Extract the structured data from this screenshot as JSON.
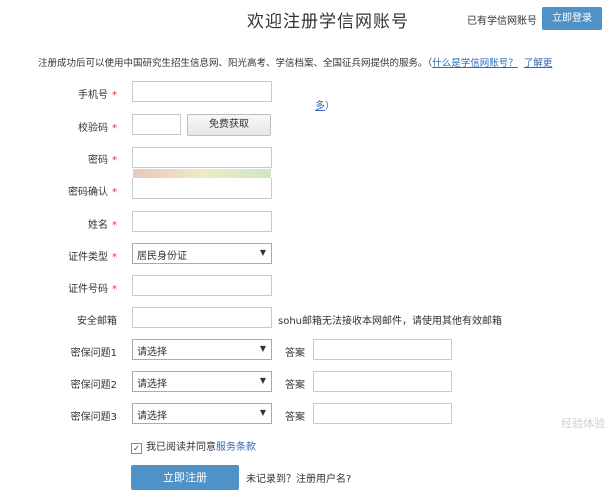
{
  "header": {
    "title": "欢迎注册学信网账号",
    "has_account": "已有学信网账号",
    "login_button": "立即登录"
  },
  "intro": {
    "text": "注册成功后可以使用中国研究生招生信息网、阳光高考、学信档案、全国征兵网提供的服务。（",
    "link1": "什么是学信网账号？",
    "link2": "了解更",
    "more": "多",
    "close_paren": "）"
  },
  "form": {
    "phone_label": "手机号",
    "code_label": "校验码",
    "code_button": "免费获取",
    "password_label": "密码",
    "password_confirm_label": "密码确认",
    "name_label": "姓名",
    "id_type_label": "证件类型",
    "id_type_value": "居民身份证",
    "id_number_label": "证件号码",
    "email_label": "安全邮箱",
    "email_hint": "sohu邮箱无法接收本网邮件，请使用其他有效邮箱",
    "q1_label": "密保问题1",
    "q2_label": "密保问题2",
    "q3_label": "密保问题3",
    "select_placeholder": "请选择",
    "answer_label": "答案",
    "required_mark": "*"
  },
  "agreement": {
    "text": "我已阅读并同意",
    "link": "服务条款",
    "checked": true
  },
  "submit_label": "立即注册",
  "footer_hint": "未记录到？注册用户名?",
  "watermark": "经验体验"
}
